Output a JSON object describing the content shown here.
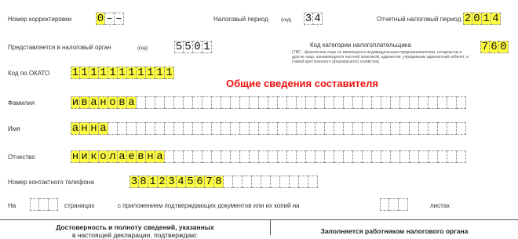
{
  "correction": {
    "label": "Номер корректировки",
    "chars": [
      "0",
      "–",
      "–"
    ]
  },
  "tax_period": {
    "label": "Налоговый период",
    "code_note": "(код)",
    "chars": [
      "3",
      "4"
    ]
  },
  "reporting_year": {
    "label": "Отчетный налоговый период",
    "chars": [
      "2",
      "0",
      "1",
      "4"
    ]
  },
  "tax_authority": {
    "label": "Представляется в налоговый орган",
    "code_note": "(код)",
    "chars": [
      "5",
      "5",
      "0",
      "1"
    ]
  },
  "taxpayer_category": {
    "label": "Код категории налогоплательщика",
    "note": "(ТВС - физическое лицо не являющееся индивидуальным предпринимателем, нотариусом и другое лицо, занимающееся частной практикой, адвокатом, учредившим адвокатский кабинет, и главой крестьянского (фермерского) хозяйства)",
    "chars": [
      "7",
      "6",
      "0"
    ]
  },
  "okato": {
    "label": "Код по ОКАТО",
    "chars": [
      "1",
      "1",
      "1",
      "1",
      "1",
      "1",
      "1",
      "1",
      "1",
      "1",
      "1"
    ]
  },
  "section_heading": "Общие сведения составителя",
  "surname": {
    "label": "Фамилия",
    "chars": [
      "и",
      "в",
      "а",
      "н",
      "о",
      "в",
      "а"
    ]
  },
  "name": {
    "label": "Имя",
    "chars": [
      "а",
      "н",
      "н",
      "а"
    ]
  },
  "patronymic": {
    "label": "Отчество",
    "chars": [
      "н",
      "и",
      "к",
      "о",
      "л",
      "а",
      "е",
      "в",
      "н",
      "а"
    ]
  },
  "phone": {
    "label": "Номер контактного телефона",
    "chars": [
      "3",
      "8",
      "1",
      "2",
      "3",
      "4",
      "5",
      "6",
      "7",
      "8"
    ]
  },
  "pages": {
    "prefix": "На",
    "suffix": "страницах",
    "attachment_text": "с приложением подтверждающих документов или их копий на",
    "sheets_suffix": "листах"
  },
  "footer": {
    "left_line1": "Достоверность и полноту сведений, указанных",
    "left_line2": "в настоящей декларации, подтверждаю:",
    "right_line1": "Заполняется работником налогового органа"
  }
}
